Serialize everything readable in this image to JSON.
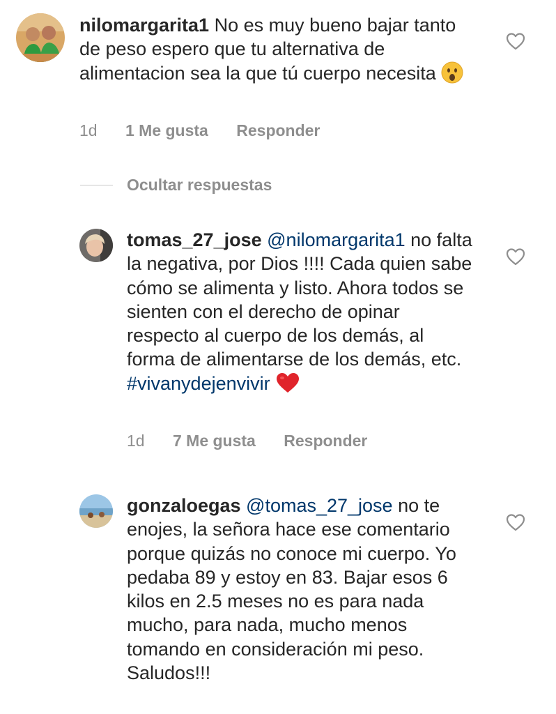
{
  "comments": [
    {
      "username": "nilomargarita1",
      "mention": "",
      "text": " No es muy bueno bajar tanto de peso espero que tu alternativa de alimentacion sea la que tú cuerpo necesita",
      "emoji": "surprised-face",
      "time": "1d",
      "likes": "1 Me gusta",
      "reply": "Responder"
    },
    {
      "username": "tomas_27_jose",
      "mention": "@nilomargarita1",
      "text": " no falta la negativa, por Dios !!!! Cada quien sabe cómo se alimenta y listo. Ahora todos se sienten con el derecho de opinar respecto al cuerpo de los demás, al forma de alimentarse de los demás, etc.",
      "hashtag": "#vivanydejenvivir",
      "emoji": "red-heart",
      "time": "1d",
      "likes": "7 Me gusta",
      "reply": "Responder"
    },
    {
      "username": "gonzaloegas",
      "mention": "@tomas_27_jose",
      "text": " no te enojes, la señora hace ese comentario porque quizás no conoce mi cuerpo. Yo pedaba 89 y estoy en 83. Bajar esos 6 kilos en 2.5 meses no es para nada mucho, para nada, mucho menos tomando en consideración mi peso. Saludos!!!"
    }
  ],
  "replies_toggle": "Ocultar respuestas",
  "colors": {
    "text": "#262626",
    "secondary": "#8e8e8e",
    "link": "#00376b",
    "heart": "#e0242b"
  }
}
